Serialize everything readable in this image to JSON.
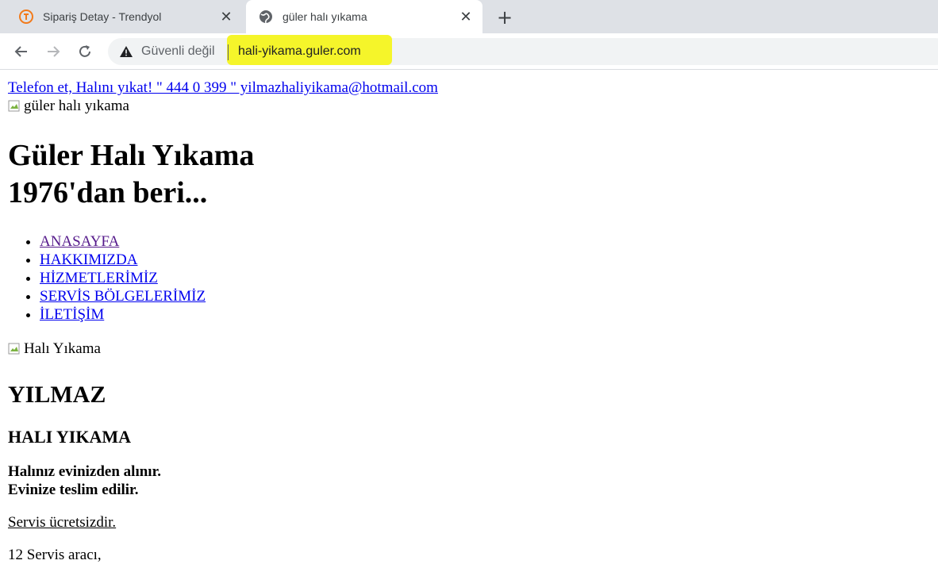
{
  "browser": {
    "tabs": [
      {
        "title": "Sipariş Detay - Trendyol",
        "favicon": "trendyol-icon",
        "active": false
      },
      {
        "title": "güler halı yıkama",
        "favicon": "globe-icon",
        "active": true
      }
    ],
    "security_label": "Güvenli değil",
    "url": "hali-yikama.guler.com",
    "highlight_color": "#f5f52a"
  },
  "page": {
    "top_link": "Telefon et, Halını yıkat! \" 444 0 399 \" yilmazhaliyikama@hotmail.com",
    "logo_alt": "güler halı yıkama",
    "title_line1": "Güler Halı Yıkama",
    "title_line2": "1976'dan beri...",
    "menu": [
      "ANASAYFA",
      "HAKKIMIZDA",
      "HİZMETLERİMİZ",
      "SERVİS BÖLGELERİMİZ",
      "İLETİŞİM"
    ],
    "banner_alt": "Halı Yıkama",
    "h2": "YILMAZ",
    "h3": "HALI YIKAMA",
    "bold_line1": "Halınız evinizden alınır.",
    "bold_line2": "Evinize teslim edilir.",
    "service_free": "Servis ücretsizdir.",
    "vehicles": "12 Servis aracı,"
  }
}
